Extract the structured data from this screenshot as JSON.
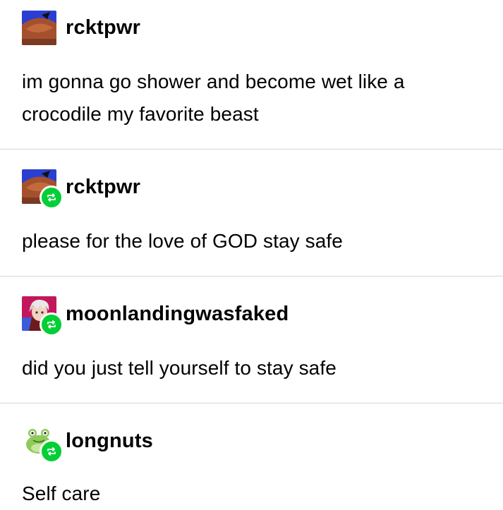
{
  "posts": [
    {
      "username": "rcktpwr",
      "avatar_icon": "bird-avatar",
      "reblog": false,
      "text": "im gonna go shower and become wet like a crocodile my favorite beast"
    },
    {
      "username": "rcktpwr",
      "avatar_icon": "bird-avatar",
      "reblog": true,
      "text": "please for the love of GOD stay safe"
    },
    {
      "username": "moonlandingwasfaked",
      "avatar_icon": "anime-character-avatar",
      "reblog": true,
      "text": "did you just tell yourself to stay safe"
    },
    {
      "username": "longnuts",
      "avatar_icon": "frog-avatar",
      "reblog": true,
      "text": "Self care"
    }
  ],
  "colors": {
    "reblog_badge": "#00cf35",
    "divider": "#d6d6d6",
    "text": "#000000"
  }
}
